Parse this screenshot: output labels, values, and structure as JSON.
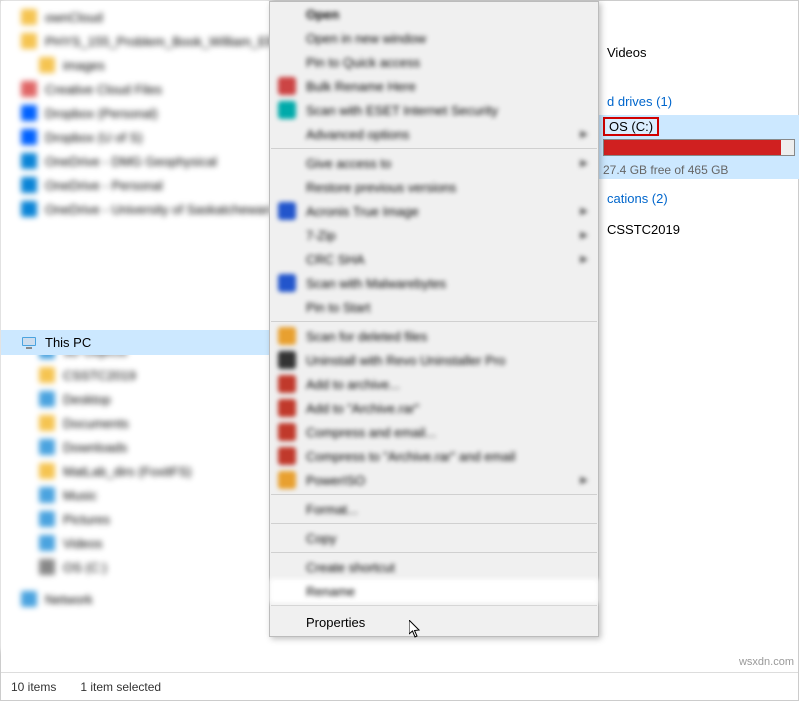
{
  "sidebar": {
    "items": [
      {
        "label": "ownCloud",
        "color": "#f5c451"
      },
      {
        "label": "PHYS_155_Problem_Book_William_Ell",
        "color": "#f5c451"
      },
      {
        "label": "images",
        "color": "#f5c451",
        "sub": true
      },
      {
        "label": "Creative Cloud Files",
        "color": "#e06666"
      },
      {
        "label": "Dropbox (Personal)",
        "color": "#0061fe"
      },
      {
        "label": "Dropbox (U of S)",
        "color": "#0061fe"
      },
      {
        "label": "OneDrive - DMG Geophysical",
        "color": "#0a84d6"
      },
      {
        "label": "OneDrive - Personal",
        "color": "#0a84d6"
      },
      {
        "label": "OneDrive - University of Saskatchewan",
        "color": "#0a84d6"
      }
    ],
    "thispc": {
      "label": "This PC"
    },
    "subitems": [
      {
        "label": "3D Objects",
        "color": "#4aa3df"
      },
      {
        "label": "CSSTC2019",
        "color": "#f5c451"
      },
      {
        "label": "Desktop",
        "color": "#4aa3df"
      },
      {
        "label": "Documents",
        "color": "#f5c451"
      },
      {
        "label": "Downloads",
        "color": "#4aa3df"
      },
      {
        "label": "MatLab_dirs (FoxitFS)",
        "color": "#f5c451"
      },
      {
        "label": "Music",
        "color": "#4aa3df"
      },
      {
        "label": "Pictures",
        "color": "#4aa3df"
      },
      {
        "label": "Videos",
        "color": "#4aa3df"
      },
      {
        "label": "OS (C:)",
        "color": "#888"
      }
    ],
    "network": {
      "label": "Network",
      "color": "#4aa3df"
    }
  },
  "context_menu": {
    "items": [
      {
        "label": "Open",
        "bold": true
      },
      {
        "label": "Open in new window"
      },
      {
        "label": "Pin to Quick access"
      },
      {
        "label": "Bulk Rename Here",
        "icon": "#c44"
      },
      {
        "label": "Scan with ESET Internet Security",
        "icon": "#0aa"
      },
      {
        "label": "Advanced options",
        "sub": true
      },
      {
        "sep": true
      },
      {
        "label": "Give access to",
        "sub": true
      },
      {
        "label": "Restore previous versions"
      },
      {
        "label": "Acronis True Image",
        "icon": "#2255cc",
        "sub": true
      },
      {
        "label": "7-Zip",
        "sub": true
      },
      {
        "label": "CRC SHA",
        "sub": true
      },
      {
        "label": "Scan with Malwarebytes",
        "icon": "#2255cc"
      },
      {
        "label": "Pin to Start"
      },
      {
        "sep": true
      },
      {
        "label": "Scan for deleted files",
        "icon": "#e8a030"
      },
      {
        "label": "Uninstall with Revo Uninstaller Pro",
        "icon": "#333"
      },
      {
        "label": "Add to archive...",
        "icon": "#c0392b"
      },
      {
        "label": "Add to \"Archive.rar\"",
        "icon": "#c0392b"
      },
      {
        "label": "Compress and email...",
        "icon": "#c0392b"
      },
      {
        "label": "Compress to \"Archive.rar\" and email",
        "icon": "#c0392b"
      },
      {
        "label": "PowerISO",
        "icon": "#e8a030",
        "sub": true
      },
      {
        "sep": true
      },
      {
        "label": "Format..."
      },
      {
        "sep": true
      },
      {
        "label": "Copy"
      },
      {
        "sep": true
      },
      {
        "label": "Create shortcut"
      },
      {
        "label": "Rename",
        "hov": true
      },
      {
        "sep": true
      }
    ],
    "final": "Properties"
  },
  "rightpane": {
    "videos": "Videos",
    "drives_heading": "d drives (1)",
    "drive_label": "OS (C:)",
    "drive_stat": "27.4 GB free of 465 GB",
    "locations_heading": "cations (2)",
    "loc1": "CSSTC2019"
  },
  "statusbar": {
    "count": "10 items",
    "selected": "1 item selected"
  },
  "watermark": "wsxdn.com"
}
